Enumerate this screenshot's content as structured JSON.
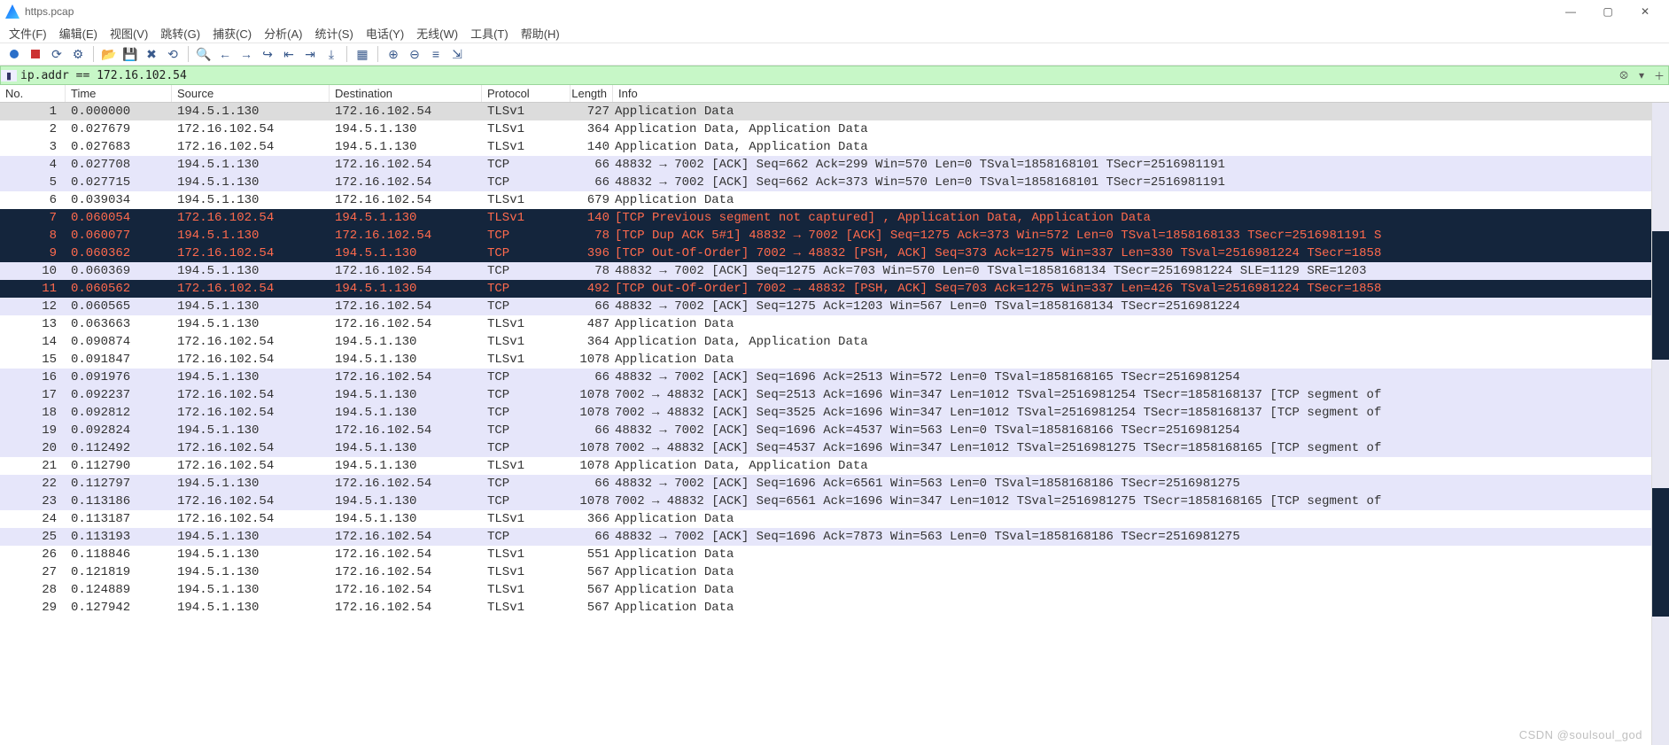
{
  "window": {
    "title": "https.pcap"
  },
  "menu": [
    "文件(F)",
    "编辑(E)",
    "视图(V)",
    "跳转(G)",
    "捕获(C)",
    "分析(A)",
    "统计(S)",
    "电话(Y)",
    "无线(W)",
    "工具(T)",
    "帮助(H)"
  ],
  "filter": {
    "value": "ip.addr == 172.16.102.54"
  },
  "columns": {
    "no": "No.",
    "time": "Time",
    "src": "Source",
    "dst": "Destination",
    "proto": "Protocol",
    "len": "Length",
    "info": "Info"
  },
  "packets": [
    {
      "no": 1,
      "time": "0.000000",
      "src": "194.5.1.130",
      "dst": "172.16.102.54",
      "proto": "TLSv1",
      "len": 727,
      "info": "Application Data",
      "cls": "sel"
    },
    {
      "no": 2,
      "time": "0.027679",
      "src": "172.16.102.54",
      "dst": "194.5.1.130",
      "proto": "TLSv1",
      "len": 364,
      "info": "Application Data, Application Data",
      "cls": ""
    },
    {
      "no": 3,
      "time": "0.027683",
      "src": "172.16.102.54",
      "dst": "194.5.1.130",
      "proto": "TLSv1",
      "len": 140,
      "info": "Application Data, Application Data",
      "cls": ""
    },
    {
      "no": 4,
      "time": "0.027708",
      "src": "194.5.1.130",
      "dst": "172.16.102.54",
      "proto": "TCP",
      "len": 66,
      "info": "48832 → 7002 [ACK] Seq=662 Ack=299 Win=570 Len=0 TSval=1858168101 TSecr=2516981191",
      "cls": "lav"
    },
    {
      "no": 5,
      "time": "0.027715",
      "src": "194.5.1.130",
      "dst": "172.16.102.54",
      "proto": "TCP",
      "len": 66,
      "info": "48832 → 7002 [ACK] Seq=662 Ack=373 Win=570 Len=0 TSval=1858168101 TSecr=2516981191",
      "cls": "lav"
    },
    {
      "no": 6,
      "time": "0.039034",
      "src": "194.5.1.130",
      "dst": "172.16.102.54",
      "proto": "TLSv1",
      "len": 679,
      "info": "Application Data",
      "cls": ""
    },
    {
      "no": 7,
      "time": "0.060054",
      "src": "172.16.102.54",
      "dst": "194.5.1.130",
      "proto": "TLSv1",
      "len": 140,
      "info": "[TCP Previous segment not captured] , Application Data, Application Data",
      "cls": "dark"
    },
    {
      "no": 8,
      "time": "0.060077",
      "src": "194.5.1.130",
      "dst": "172.16.102.54",
      "proto": "TCP",
      "len": 78,
      "info": "[TCP Dup ACK 5#1] 48832 → 7002 [ACK] Seq=1275 Ack=373 Win=572 Len=0 TSval=1858168133 TSecr=2516981191 S",
      "cls": "dark"
    },
    {
      "no": 9,
      "time": "0.060362",
      "src": "172.16.102.54",
      "dst": "194.5.1.130",
      "proto": "TCP",
      "len": 396,
      "info": "[TCP Out-Of-Order] 7002 → 48832 [PSH, ACK] Seq=373 Ack=1275 Win=337 Len=330 TSval=2516981224 TSecr=1858",
      "cls": "dark"
    },
    {
      "no": 10,
      "time": "0.060369",
      "src": "194.5.1.130",
      "dst": "172.16.102.54",
      "proto": "TCP",
      "len": 78,
      "info": "48832 → 7002 [ACK] Seq=1275 Ack=703 Win=570 Len=0 TSval=1858168134 TSecr=2516981224 SLE=1129 SRE=1203",
      "cls": "lav"
    },
    {
      "no": 11,
      "time": "0.060562",
      "src": "172.16.102.54",
      "dst": "194.5.1.130",
      "proto": "TCP",
      "len": 492,
      "info": "[TCP Out-Of-Order] 7002 → 48832 [PSH, ACK] Seq=703 Ack=1275 Win=337 Len=426 TSval=2516981224 TSecr=1858",
      "cls": "dark"
    },
    {
      "no": 12,
      "time": "0.060565",
      "src": "194.5.1.130",
      "dst": "172.16.102.54",
      "proto": "TCP",
      "len": 66,
      "info": "48832 → 7002 [ACK] Seq=1275 Ack=1203 Win=567 Len=0 TSval=1858168134 TSecr=2516981224",
      "cls": "lav"
    },
    {
      "no": 13,
      "time": "0.063663",
      "src": "194.5.1.130",
      "dst": "172.16.102.54",
      "proto": "TLSv1",
      "len": 487,
      "info": "Application Data",
      "cls": ""
    },
    {
      "no": 14,
      "time": "0.090874",
      "src": "172.16.102.54",
      "dst": "194.5.1.130",
      "proto": "TLSv1",
      "len": 364,
      "info": "Application Data, Application Data",
      "cls": ""
    },
    {
      "no": 15,
      "time": "0.091847",
      "src": "172.16.102.54",
      "dst": "194.5.1.130",
      "proto": "TLSv1",
      "len": 1078,
      "info": "Application Data",
      "cls": ""
    },
    {
      "no": 16,
      "time": "0.091976",
      "src": "194.5.1.130",
      "dst": "172.16.102.54",
      "proto": "TCP",
      "len": 66,
      "info": "48832 → 7002 [ACK] Seq=1696 Ack=2513 Win=572 Len=0 TSval=1858168165 TSecr=2516981254",
      "cls": "lav"
    },
    {
      "no": 17,
      "time": "0.092237",
      "src": "172.16.102.54",
      "dst": "194.5.1.130",
      "proto": "TCP",
      "len": 1078,
      "info": "7002 → 48832 [ACK] Seq=2513 Ack=1696 Win=347 Len=1012 TSval=2516981254 TSecr=1858168137 [TCP segment of",
      "cls": "lav"
    },
    {
      "no": 18,
      "time": "0.092812",
      "src": "172.16.102.54",
      "dst": "194.5.1.130",
      "proto": "TCP",
      "len": 1078,
      "info": "7002 → 48832 [ACK] Seq=3525 Ack=1696 Win=347 Len=1012 TSval=2516981254 TSecr=1858168137 [TCP segment of",
      "cls": "lav"
    },
    {
      "no": 19,
      "time": "0.092824",
      "src": "194.5.1.130",
      "dst": "172.16.102.54",
      "proto": "TCP",
      "len": 66,
      "info": "48832 → 7002 [ACK] Seq=1696 Ack=4537 Win=563 Len=0 TSval=1858168166 TSecr=2516981254",
      "cls": "lav"
    },
    {
      "no": 20,
      "time": "0.112492",
      "src": "172.16.102.54",
      "dst": "194.5.1.130",
      "proto": "TCP",
      "len": 1078,
      "info": "7002 → 48832 [ACK] Seq=4537 Ack=1696 Win=347 Len=1012 TSval=2516981275 TSecr=1858168165 [TCP segment of",
      "cls": "lav"
    },
    {
      "no": 21,
      "time": "0.112790",
      "src": "172.16.102.54",
      "dst": "194.5.1.130",
      "proto": "TLSv1",
      "len": 1078,
      "info": "Application Data, Application Data",
      "cls": ""
    },
    {
      "no": 22,
      "time": "0.112797",
      "src": "194.5.1.130",
      "dst": "172.16.102.54",
      "proto": "TCP",
      "len": 66,
      "info": "48832 → 7002 [ACK] Seq=1696 Ack=6561 Win=563 Len=0 TSval=1858168186 TSecr=2516981275",
      "cls": "lav"
    },
    {
      "no": 23,
      "time": "0.113186",
      "src": "172.16.102.54",
      "dst": "194.5.1.130",
      "proto": "TCP",
      "len": 1078,
      "info": "7002 → 48832 [ACK] Seq=6561 Ack=1696 Win=347 Len=1012 TSval=2516981275 TSecr=1858168165 [TCP segment of",
      "cls": "lav"
    },
    {
      "no": 24,
      "time": "0.113187",
      "src": "172.16.102.54",
      "dst": "194.5.1.130",
      "proto": "TLSv1",
      "len": 366,
      "info": "Application Data",
      "cls": ""
    },
    {
      "no": 25,
      "time": "0.113193",
      "src": "194.5.1.130",
      "dst": "172.16.102.54",
      "proto": "TCP",
      "len": 66,
      "info": "48832 → 7002 [ACK] Seq=1696 Ack=7873 Win=563 Len=0 TSval=1858168186 TSecr=2516981275",
      "cls": "lav"
    },
    {
      "no": 26,
      "time": "0.118846",
      "src": "194.5.1.130",
      "dst": "172.16.102.54",
      "proto": "TLSv1",
      "len": 551,
      "info": "Application Data",
      "cls": ""
    },
    {
      "no": 27,
      "time": "0.121819",
      "src": "194.5.1.130",
      "dst": "172.16.102.54",
      "proto": "TLSv1",
      "len": 567,
      "info": "Application Data",
      "cls": ""
    },
    {
      "no": 28,
      "time": "0.124889",
      "src": "194.5.1.130",
      "dst": "172.16.102.54",
      "proto": "TLSv1",
      "len": 567,
      "info": "Application Data",
      "cls": ""
    },
    {
      "no": 29,
      "time": "0.127942",
      "src": "194.5.1.130",
      "dst": "172.16.102.54",
      "proto": "TLSv1",
      "len": 567,
      "info": "Application Data",
      "cls": ""
    }
  ],
  "credit": "CSDN @soulsoul_god"
}
